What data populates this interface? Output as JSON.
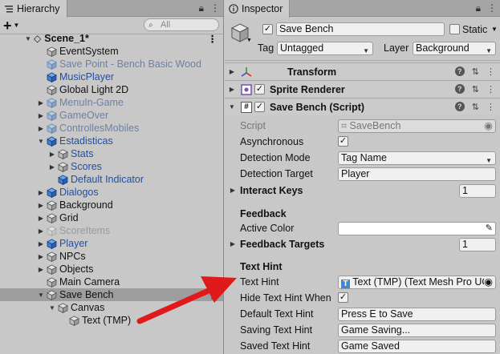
{
  "hierarchy": {
    "tab_title": "Hierarchy",
    "search_placeholder": "All",
    "scene_name": "Scene_1*",
    "items": [
      {
        "label": "EventSystem",
        "style": "normal",
        "icon": "gameobject",
        "depth": 0,
        "arrow": ""
      },
      {
        "label": "Save Point - Bench Basic Wood",
        "style": "faded",
        "icon": "prefab-faded",
        "depth": 0,
        "arrow": ""
      },
      {
        "label": "MusicPlayer",
        "style": "prefab",
        "icon": "prefab",
        "depth": 0,
        "arrow": ""
      },
      {
        "label": "Global Light 2D",
        "style": "normal",
        "icon": "gameobject",
        "depth": 0,
        "arrow": ""
      },
      {
        "label": "MenuIn-Game",
        "style": "faded",
        "icon": "prefab-faded",
        "depth": 0,
        "arrow": "right"
      },
      {
        "label": "GameOver",
        "style": "faded",
        "icon": "prefab-faded",
        "depth": 0,
        "arrow": "right"
      },
      {
        "label": "ControllesMobiles",
        "style": "faded",
        "icon": "prefab-faded",
        "depth": 0,
        "arrow": "right"
      },
      {
        "label": "Estadisticas",
        "style": "prefab",
        "icon": "prefab",
        "depth": 0,
        "arrow": "down"
      },
      {
        "label": "Stats",
        "style": "prefab",
        "icon": "gameobject",
        "depth": 1,
        "arrow": "right"
      },
      {
        "label": "Scores",
        "style": "prefab",
        "icon": "gameobject",
        "depth": 1,
        "arrow": "right"
      },
      {
        "label": "Default Indicator",
        "style": "prefab",
        "icon": "prefab",
        "depth": 1,
        "arrow": ""
      },
      {
        "label": "Dialogos",
        "style": "prefab",
        "icon": "prefab",
        "depth": 0,
        "arrow": "right"
      },
      {
        "label": "Background",
        "style": "normal",
        "icon": "gameobject",
        "depth": 0,
        "arrow": "right"
      },
      {
        "label": "Grid",
        "style": "normal",
        "icon": "gameobject",
        "depth": 0,
        "arrow": "right"
      },
      {
        "label": "ScoreItems",
        "style": "grey",
        "icon": "gameobject-faded",
        "depth": 0,
        "arrow": "right"
      },
      {
        "label": "Player",
        "style": "prefab",
        "icon": "prefab",
        "depth": 0,
        "arrow": "right"
      },
      {
        "label": "NPCs",
        "style": "normal",
        "icon": "gameobject",
        "depth": 0,
        "arrow": "right"
      },
      {
        "label": "Objects",
        "style": "normal",
        "icon": "gameobject",
        "depth": 0,
        "arrow": "right"
      },
      {
        "label": "Main Camera",
        "style": "normal",
        "icon": "gameobject",
        "depth": 0,
        "arrow": ""
      },
      {
        "label": "Save Bench",
        "style": "normal",
        "icon": "gameobject",
        "depth": 0,
        "arrow": "down",
        "selected": true
      },
      {
        "label": "Canvas",
        "style": "normal",
        "icon": "gameobject",
        "depth": 1,
        "arrow": "down"
      },
      {
        "label": "Text (TMP)",
        "style": "normal",
        "icon": "gameobject",
        "depth": 2,
        "arrow": ""
      }
    ]
  },
  "inspector": {
    "tab_title": "Inspector",
    "object_name": "Save Bench",
    "static_label": "Static",
    "tag_label": "Tag",
    "tag_value": "Untagged",
    "layer_label": "Layer",
    "layer_value": "Background",
    "components": {
      "transform": "Transform",
      "sprite_renderer": "Sprite Renderer",
      "save_bench": "Save Bench (Script)"
    },
    "props": {
      "script_label": "Script",
      "script_value": "SaveBench",
      "asynchronous_label": "Asynchronous",
      "detection_mode_label": "Detection Mode",
      "detection_mode_value": "Tag Name",
      "detection_target_label": "Detection Target",
      "detection_target_value": "Player",
      "interact_keys_label": "Interact Keys",
      "interact_keys_value": "1",
      "feedback_header": "Feedback",
      "active_color_label": "Active Color",
      "feedback_targets_label": "Feedback Targets",
      "feedback_targets_value": "1",
      "text_hint_header": "Text Hint",
      "text_hint_label": "Text Hint",
      "text_hint_value": "Text (TMP) (Text Mesh Pro UG",
      "hide_text_hint_label": "Hide Text Hint When",
      "default_text_hint_label": "Default Text Hint",
      "default_text_hint_value": "Press E to Save",
      "saving_text_hint_label": "Saving Text Hint",
      "saving_text_hint_value": "Game Saving...",
      "saved_text_hint_label": "Saved Text Hint",
      "saved_text_hint_value": "Game Saved"
    }
  },
  "colors": {
    "prefab_blue": "#1f4fa8",
    "annotation_arrow": "#e0191b"
  }
}
